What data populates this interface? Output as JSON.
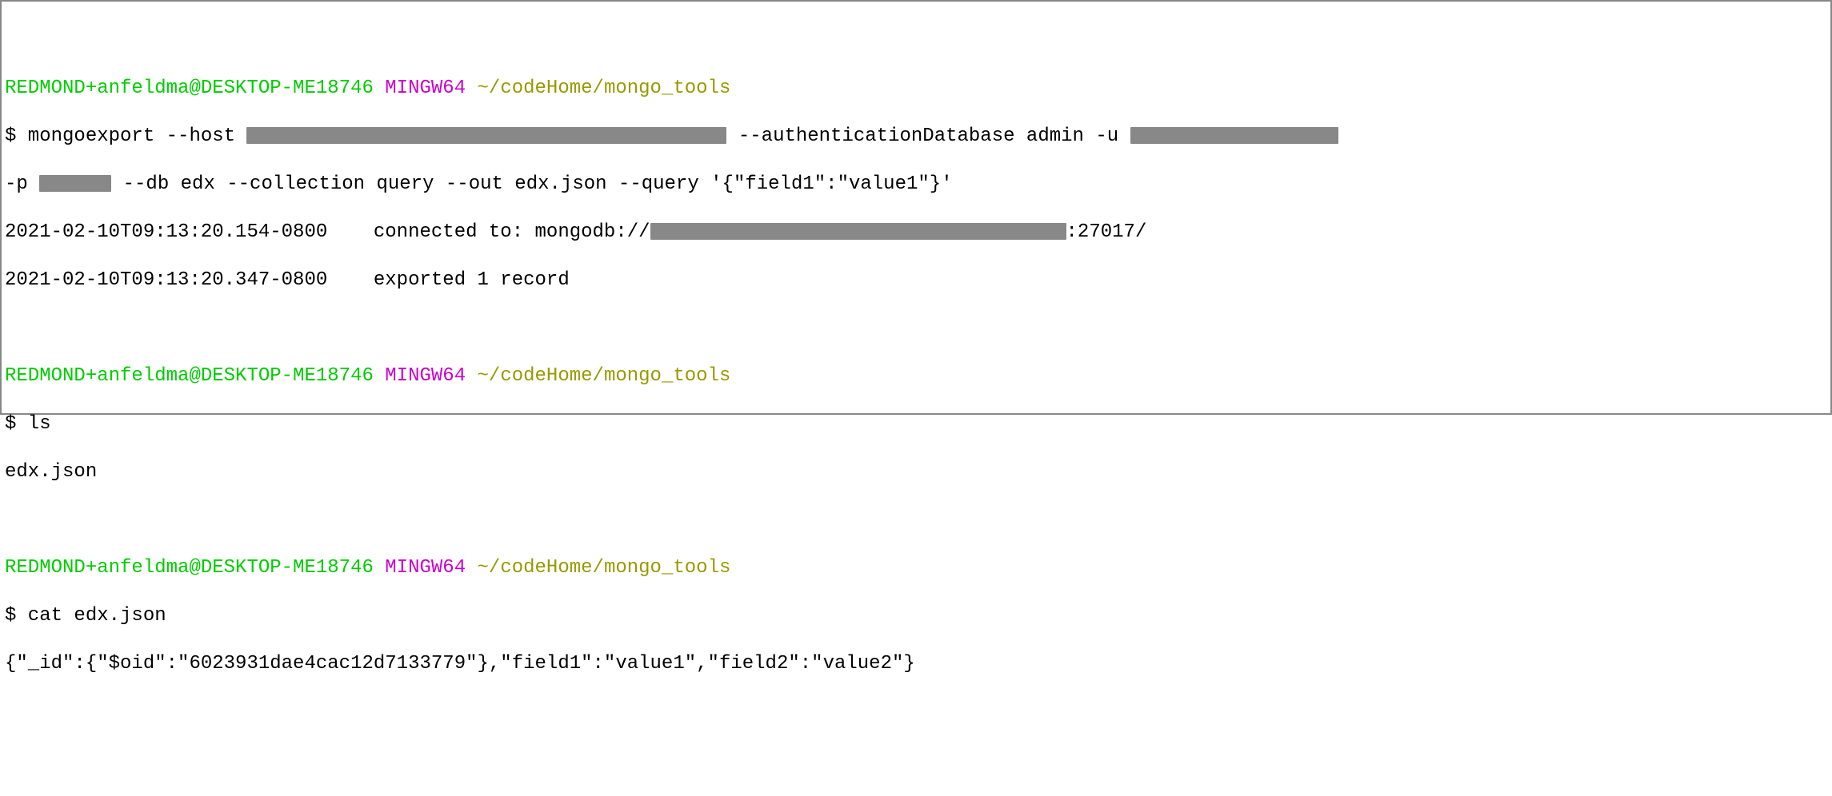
{
  "prompt": {
    "user": "REDMOND+anfeldma@DESKTOP-ME18746",
    "env": "MINGW64",
    "path": "~/codeHome/mongo_tools"
  },
  "block1": {
    "cmd_prefix": "$ mongoexport --host ",
    "cmd_after_host": " --authenticationDatabase admin -u ",
    "line2_prefix": "-p ",
    "line2_after_pass": " --db edx --collection query --out edx.json --query '{\"field1\":\"value1\"}'",
    "line3_prefix": "2021-02-10T09:13:20.154-0800    connected to: mongodb://",
    "line3_suffix": ":27017/",
    "line4": "2021-02-10T09:13:20.347-0800    exported 1 record"
  },
  "block2": {
    "cmd": "$ ls",
    "output": "edx.json"
  },
  "block3": {
    "cmd": "$ cat edx.json",
    "output": "{\"_id\":{\"$oid\":\"6023931dae4cac12d7133779\"},\"field1\":\"value1\",\"field2\":\"value2\"}"
  }
}
